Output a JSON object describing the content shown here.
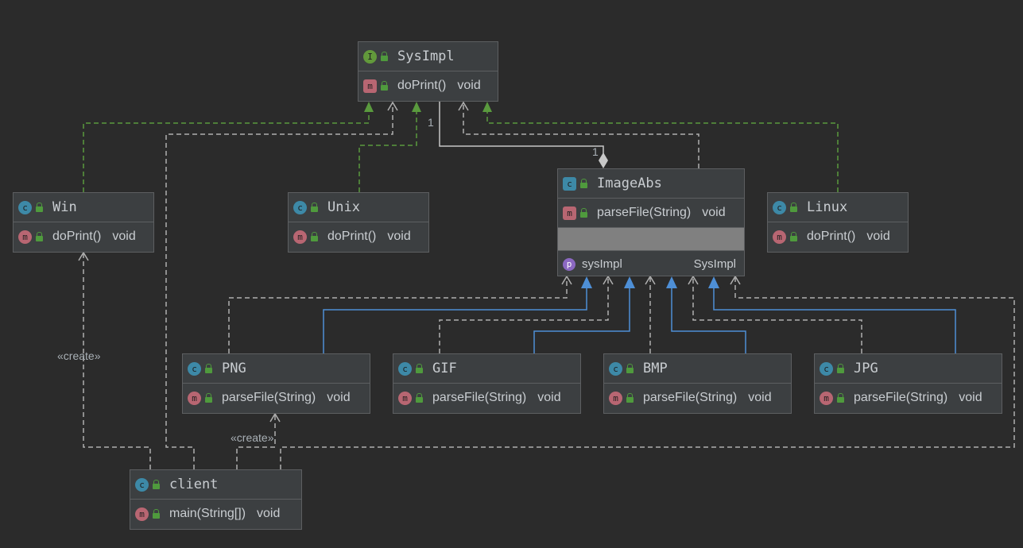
{
  "classes": {
    "sysimpl": {
      "name": "SysImpl",
      "kind": "I",
      "method": "doPrint()",
      "type": "void"
    },
    "win": {
      "name": "Win",
      "kind": "c",
      "method": "doPrint()",
      "type": "void"
    },
    "unix": {
      "name": "Unix",
      "kind": "c",
      "method": "doPrint()",
      "type": "void"
    },
    "imageabs": {
      "name": "ImageAbs",
      "kind": "c",
      "method": "parseFile(String)",
      "type": "void",
      "field": "sysImpl",
      "field_type": "SysImpl"
    },
    "linux": {
      "name": "Linux",
      "kind": "c",
      "method": "doPrint()",
      "type": "void"
    },
    "png": {
      "name": "PNG",
      "kind": "c",
      "method": "parseFile(String)",
      "type": "void"
    },
    "gif": {
      "name": "GIF",
      "kind": "c",
      "method": "parseFile(String)",
      "type": "void"
    },
    "bmp": {
      "name": "BMP",
      "kind": "c",
      "method": "parseFile(String)",
      "type": "void"
    },
    "jpg": {
      "name": "JPG",
      "kind": "c",
      "method": "parseFile(String)",
      "type": "void"
    },
    "client": {
      "name": "client",
      "kind": "c",
      "method": "main(String[])",
      "type": "void"
    }
  },
  "icons": {
    "class": "c",
    "interface": "I",
    "method": "m",
    "property": "p"
  },
  "labels": {
    "create_win": "«create»",
    "create_png": "«create»",
    "mult_sys": "1",
    "mult_img": "1"
  },
  "colors": {
    "background": "#2b2b2b",
    "node": "#3c3f41",
    "realization": "#5a9a3e",
    "inheritance": "#4e8fd6",
    "dependency": "#b0b0b0"
  }
}
